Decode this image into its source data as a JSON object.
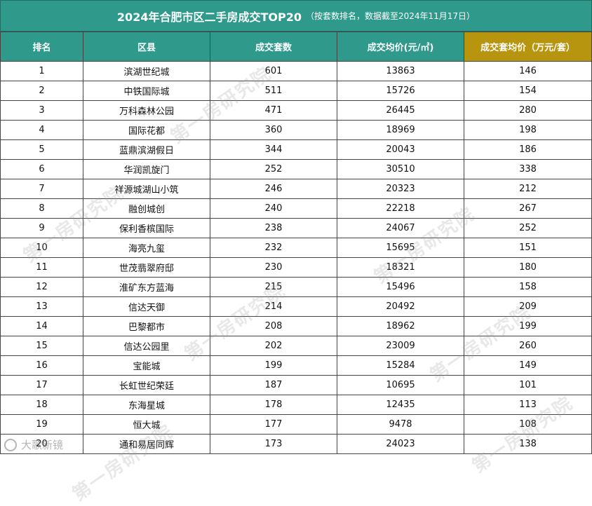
{
  "title": {
    "main": "2024年合肥市区二手房成交TOP20",
    "note": "（按套数排名，数据截至2024年11月17日）"
  },
  "columns": [
    "排名",
    "区县",
    "成交套数",
    "成交均价(元/㎡)",
    "成交套均价（万元/套）"
  ],
  "rows": [
    [
      "1",
      "滨湖世纪城",
      "601",
      "13863",
      "146"
    ],
    [
      "2",
      "中铁国际城",
      "511",
      "15726",
      "154"
    ],
    [
      "3",
      "万科森林公园",
      "471",
      "26445",
      "280"
    ],
    [
      "4",
      "国际花都",
      "360",
      "18969",
      "198"
    ],
    [
      "5",
      "蓝鼎滨湖假日",
      "344",
      "20043",
      "186"
    ],
    [
      "6",
      "华润凯旋门",
      "252",
      "30510",
      "338"
    ],
    [
      "7",
      "祥源城湖山小筑",
      "246",
      "20323",
      "212"
    ],
    [
      "8",
      "融创城创",
      "240",
      "22218",
      "267"
    ],
    [
      "9",
      "保利香槟国际",
      "238",
      "24067",
      "252"
    ],
    [
      "10",
      "海亮九玺",
      "232",
      "15695",
      "151"
    ],
    [
      "11",
      "世茂翡翠府邸",
      "230",
      "18321",
      "180"
    ],
    [
      "12",
      "淮矿东方蓝海",
      "215",
      "15496",
      "158"
    ],
    [
      "13",
      "信达天御",
      "214",
      "20492",
      "209"
    ],
    [
      "14",
      "巴黎都市",
      "208",
      "18962",
      "199"
    ],
    [
      "15",
      "信达公园里",
      "202",
      "23009",
      "260"
    ],
    [
      "16",
      "宝能城",
      "199",
      "15284",
      "149"
    ],
    [
      "17",
      "长虹世纪荣廷",
      "187",
      "10695",
      "101"
    ],
    [
      "18",
      "东海星城",
      "178",
      "12435",
      "113"
    ],
    [
      "19",
      "恒大城",
      "177",
      "9478",
      "108"
    ],
    [
      "20",
      "通和易居同辉",
      "173",
      "24023",
      "138"
    ]
  ],
  "watermark": "第一房研究院",
  "logo_text": "大歌新镜",
  "colors": {
    "header": "#2f9a8b",
    "header_highlight": "#b8950f",
    "border": "#444444"
  }
}
